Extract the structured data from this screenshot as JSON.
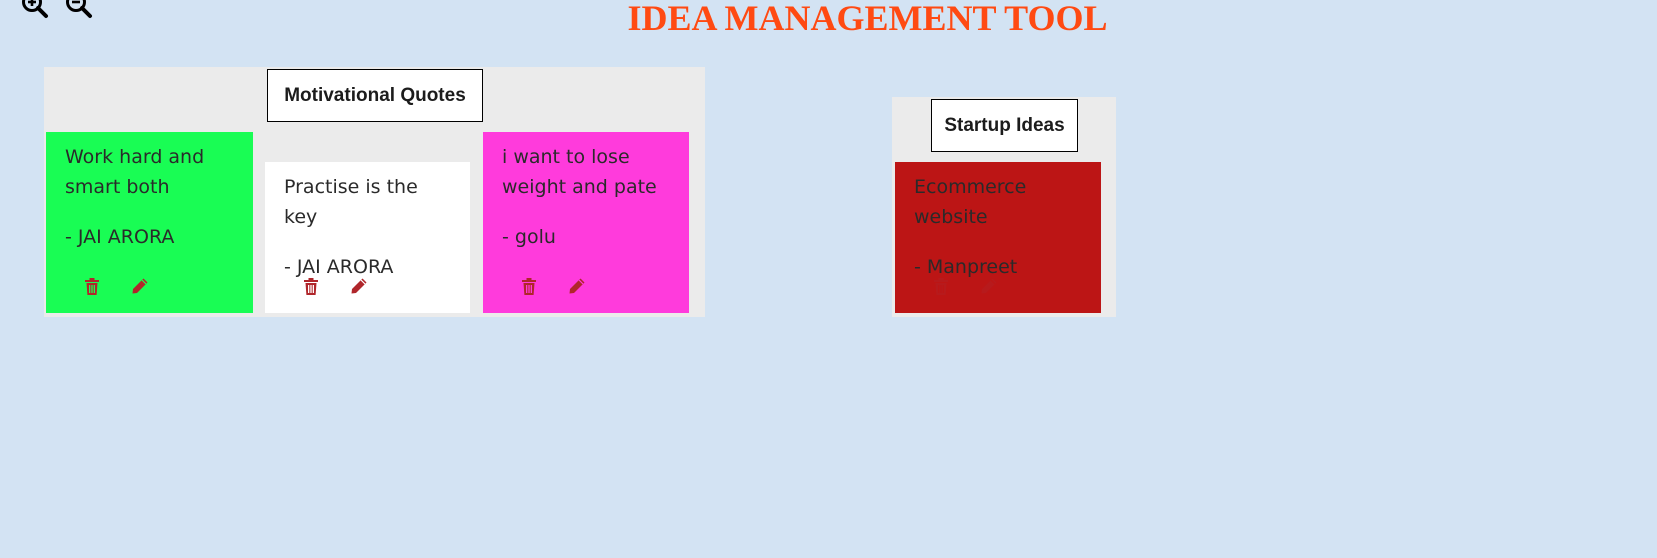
{
  "app": {
    "title": "IDEA MANAGEMENT TOOL"
  },
  "toolbar": {
    "zoom_in_icon": "zoom-in-icon",
    "zoom_out_icon": "zoom-out-icon"
  },
  "boards": [
    {
      "title": "Motivational Quotes",
      "notes": [
        {
          "text": "Work hard and smart both",
          "author": "- JAI ARORA",
          "color": "#19fd54"
        },
        {
          "text": "Practise is the key",
          "author": "- JAI ARORA",
          "color": "#ffffff"
        },
        {
          "text": "i want to lose weight and pate",
          "author": "- golu",
          "color": "#ff3bdc"
        }
      ]
    },
    {
      "title": "Startup Ideas",
      "notes": [
        {
          "text": "Ecommerce website",
          "author": "- Manpreet",
          "color": "#bc1515"
        }
      ]
    }
  ],
  "colors": {
    "background": "#d3e3f3",
    "title": "#ff4a12",
    "board": "#ebebeb",
    "action_icon": "#b0262b"
  },
  "icons": {
    "delete": "trash-icon",
    "edit": "pencil-icon"
  }
}
